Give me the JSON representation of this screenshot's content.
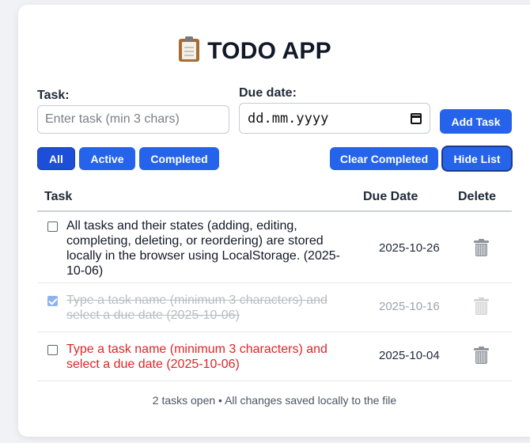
{
  "app": {
    "title": "TODO APP",
    "title_icon": "clipboard-icon"
  },
  "form": {
    "task_label": "Task:",
    "task_placeholder": "Enter task (min 3 chars)",
    "task_value": "",
    "due_label": "Due date:",
    "due_value": "dd.mm.yyyy",
    "add_button": "Add Task"
  },
  "filters": {
    "all": "All",
    "active": "Active",
    "completed": "Completed",
    "selected": "All",
    "clear_completed": "Clear Completed",
    "hide_list": "Hide List"
  },
  "table": {
    "headers": {
      "task": "Task",
      "due": "Due Date",
      "delete": "Delete"
    },
    "rows": [
      {
        "checked": false,
        "text": "All tasks and their states (adding, editing, completing, deleting, or reordering) are stored locally in the browser using LocalStorage. (2025-10-06)",
        "due": "2025-10-26",
        "state": "normal"
      },
      {
        "checked": true,
        "text": "Type a task name (minimum 3 characters) and select a due date (2025-10-06)",
        "due": "2025-10-16",
        "state": "completed"
      },
      {
        "checked": false,
        "text": "Type a task name (minimum 3 characters) and select a due date (2025-10-06)",
        "due": "2025-10-04",
        "state": "overdue"
      }
    ]
  },
  "footer": {
    "status": "2 tasks open • All changes saved locally to the file"
  },
  "colors": {
    "primary": "#2563eb",
    "overdue": "#dc2626",
    "completed_text": "#b8bcc2"
  }
}
